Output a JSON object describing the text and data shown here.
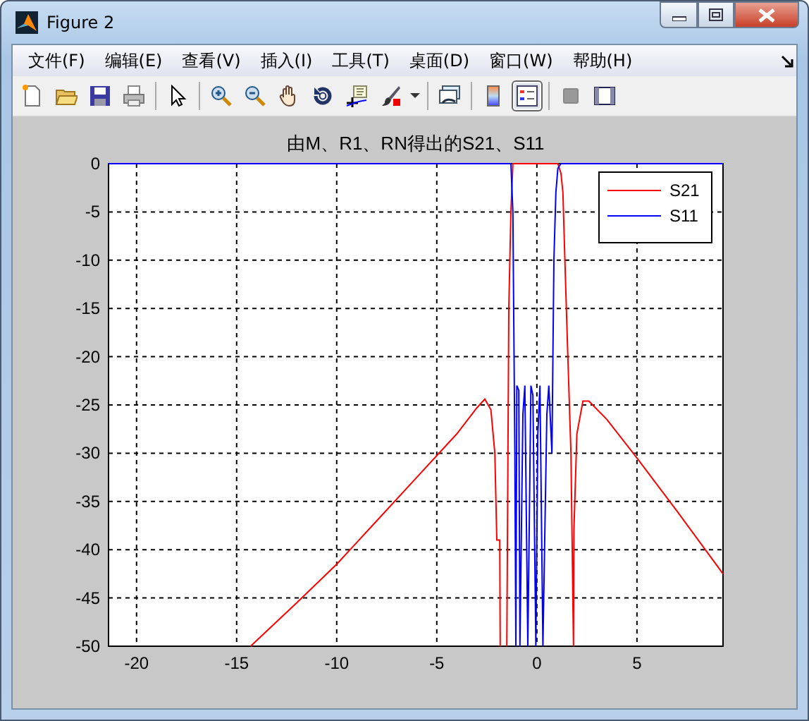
{
  "window": {
    "title": "Figure 2"
  },
  "menu": [
    {
      "label": "文件(F)"
    },
    {
      "label": "编辑(E)"
    },
    {
      "label": "查看(V)"
    },
    {
      "label": "插入(I)"
    },
    {
      "label": "工具(T)"
    },
    {
      "label": "桌面(D)"
    },
    {
      "label": "窗口(W)"
    },
    {
      "label": "帮助(H)"
    }
  ],
  "toolbar_groups": [
    {
      "buttons": [
        {
          "kind": "new",
          "selected": false
        },
        {
          "kind": "open",
          "selected": false
        },
        {
          "kind": "save",
          "selected": false
        },
        {
          "kind": "print",
          "selected": false
        }
      ]
    },
    {
      "buttons": [
        {
          "kind": "pointer",
          "selected": false
        }
      ]
    },
    {
      "buttons": [
        {
          "kind": "zoom-in",
          "selected": false
        },
        {
          "kind": "zoom-out",
          "selected": false
        },
        {
          "kind": "pan",
          "selected": false
        },
        {
          "kind": "rotate",
          "selected": false
        },
        {
          "kind": "data-cursor",
          "selected": false
        },
        {
          "kind": "brush",
          "selected": false
        },
        {
          "kind": "dropdown",
          "selected": false
        }
      ]
    },
    {
      "buttons": [
        {
          "kind": "link",
          "selected": false
        }
      ]
    },
    {
      "buttons": [
        {
          "kind": "colorbar",
          "selected": false
        },
        {
          "kind": "legend",
          "selected": true
        }
      ]
    },
    {
      "buttons": [
        {
          "kind": "hide-tools",
          "selected": false
        },
        {
          "kind": "show-tools",
          "selected": false
        }
      ]
    }
  ],
  "plot": {
    "chart_data": {
      "type": "line",
      "title": "由M、R1、RN得出的S21、S11",
      "grid": true,
      "legend": true,
      "x": [
        -21.4,
        -14.3,
        -12,
        -10,
        -8,
        -6,
        -4,
        -3,
        -2.6,
        -2.3,
        -2.1,
        -2.0,
        -1.85,
        -1.83,
        -1.55,
        -1.5,
        -1.4,
        -1.3,
        -1.2,
        -1.1,
        -1.05,
        -1.0,
        -0.9,
        -0.85,
        -0.7,
        -0.6,
        -0.45,
        -0.3,
        -0.2,
        -0.05,
        0.05,
        0.15,
        0.3,
        0.5,
        0.6,
        0.75,
        0.85,
        0.95,
        1.05,
        1.2,
        1.3,
        1.4,
        1.55,
        1.7,
        1.83,
        1.85,
        2.0,
        2.3,
        2.6,
        3.5,
        5,
        7,
        9.3
      ],
      "series": [
        {
          "name": "S21",
          "color": "#ff0000",
          "values": [
            null,
            -50,
            -45.5,
            -41.5,
            -37,
            -32.5,
            -28,
            -25.3,
            -24.4,
            -25.5,
            -30,
            -39,
            -39,
            -50,
            null,
            -50,
            -15,
            -5,
            0,
            0,
            0,
            0,
            0,
            0,
            0,
            0,
            0,
            0,
            0,
            0,
            0,
            0,
            0,
            0,
            0,
            0,
            0,
            0,
            0,
            -1,
            -3,
            -10,
            -20,
            -30,
            -50,
            -38,
            -28,
            -24.6,
            -24.6,
            -26.5,
            -30.5,
            -36,
            -42.5
          ]
        },
        {
          "name": "S11",
          "color": "#0000ff",
          "values": [
            0,
            0,
            0,
            0,
            0,
            0,
            0,
            0,
            0,
            0,
            0,
            0,
            0,
            0,
            0,
            0,
            0,
            0,
            -5,
            -30,
            -50,
            -23,
            -23.5,
            -50,
            -26,
            -23,
            -50,
            -23,
            -24,
            -50,
            -28,
            -23,
            -50,
            -26,
            -23,
            -30,
            -10,
            -3,
            -0.5,
            0,
            0,
            0,
            0,
            0,
            0,
            0,
            0,
            0,
            0,
            0,
            0,
            0,
            0
          ]
        }
      ],
      "xlim": [
        -21.4,
        9.3
      ],
      "ylim": [
        -50,
        0
      ],
      "xticks": [
        -20,
        -15,
        -10,
        -5,
        0,
        5
      ],
      "yticks": [
        0,
        -5,
        -10,
        -15,
        -20,
        -25,
        -30,
        -35,
        -40,
        -45,
        -50
      ]
    }
  }
}
